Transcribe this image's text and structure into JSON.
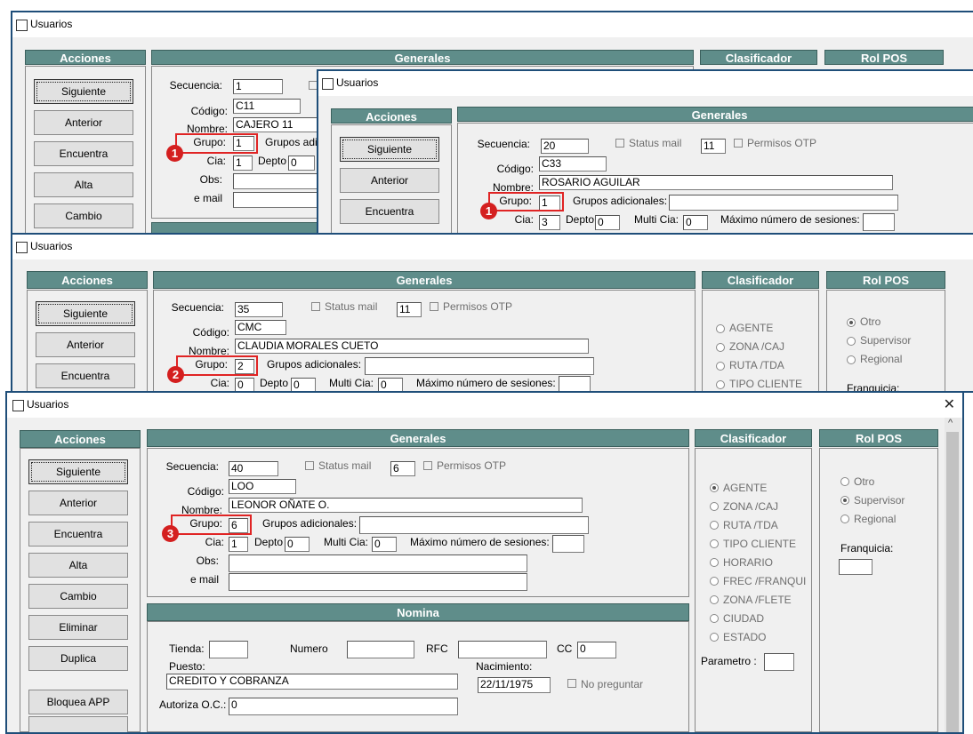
{
  "window_title": "Usuarios",
  "close_glyph": "✕",
  "scroll_up_glyph": "^",
  "headers": {
    "acciones": "Acciones",
    "generales": "Generales",
    "clasificador": "Clasificador",
    "rol_pos": "Rol POS",
    "nomina": "Nomina"
  },
  "buttons": {
    "siguiente": "Siguiente",
    "anterior": "Anterior",
    "encuentra": "Encuentra",
    "alta": "Alta",
    "cambio": "Cambio",
    "eliminar": "Eliminar",
    "duplica": "Duplica",
    "bloquea_app": "Bloquea APP"
  },
  "labels": {
    "secuencia": "Secuencia:",
    "codigo": "Código:",
    "nombre": "Nombre:",
    "grupo": "Grupo:",
    "grupos_adicionales": "Grupos adicionales:",
    "grupos_adi_truncated": "Grupos adi",
    "cia": "Cia:",
    "depto": "Depto",
    "multi_cia": "Multi Cia:",
    "max_sesiones": "Máximo número de sesiones:",
    "obs": "Obs:",
    "email": "e mail",
    "status_mail": "Status mail",
    "permisos_otp": "Permisos OTP",
    "franquicia": "Franquicia:",
    "franquicia_partial": "Franquicia:",
    "parametro": "Parametro :",
    "tienda": "Tienda:",
    "numero": "Numero",
    "rfc": "RFC",
    "cc": "CC",
    "puesto": "Puesto:",
    "nacimiento": "Nacimiento:",
    "no_preguntar": "No preguntar",
    "autoriza_oc": "Autoriza O.C.:"
  },
  "clasificador_options": [
    "AGENTE",
    "ZONA /CAJ",
    "RUTA /TDA",
    "TIPO CLIENTE",
    "HORARIO",
    "FREC /FRANQUI",
    "ZONA /FLETE",
    "CIUDAD",
    "ESTADO"
  ],
  "rol_options": [
    "Otro",
    "Supervisor",
    "Regional"
  ],
  "colors": {
    "header_teal": "#5f8d8a",
    "window_border": "#1f4e79",
    "highlight_red": "#e02424",
    "badge_red": "#d41f1f"
  },
  "records": {
    "r1": {
      "secuencia": "1",
      "codigo": "C11",
      "nombre": "CAJERO 11",
      "grupo": "1",
      "cia": "1",
      "depto": "0",
      "badge": "1"
    },
    "r2": {
      "secuencia": "20",
      "status_mail_num": "11",
      "codigo": "C33",
      "nombre": "ROSARIO AGUILAR",
      "grupo": "1",
      "cia": "3",
      "depto": "0",
      "multi_cia": "0",
      "badge": "1"
    },
    "r3": {
      "secuencia": "35",
      "status_mail_num": "11",
      "codigo": "CMC",
      "nombre": "CLAUDIA MORALES CUETO",
      "grupo": "2",
      "cia": "0",
      "depto": "0",
      "multi_cia": "0",
      "badge": "2",
      "rol_selected": "Otro"
    },
    "r4": {
      "secuencia": "40",
      "status_mail_num": "6",
      "codigo": "LOO",
      "nombre": "LEONOR OÑATE O.",
      "grupo": "6",
      "cia": "1",
      "depto": "0",
      "multi_cia": "0",
      "badge": "3",
      "clasificador_selected": "AGENTE",
      "rol_selected": "Supervisor",
      "cc": "0",
      "puesto": "CREDITO Y COBRANZA",
      "nacimiento": "22/11/1975",
      "autoriza_oc": "0"
    }
  }
}
